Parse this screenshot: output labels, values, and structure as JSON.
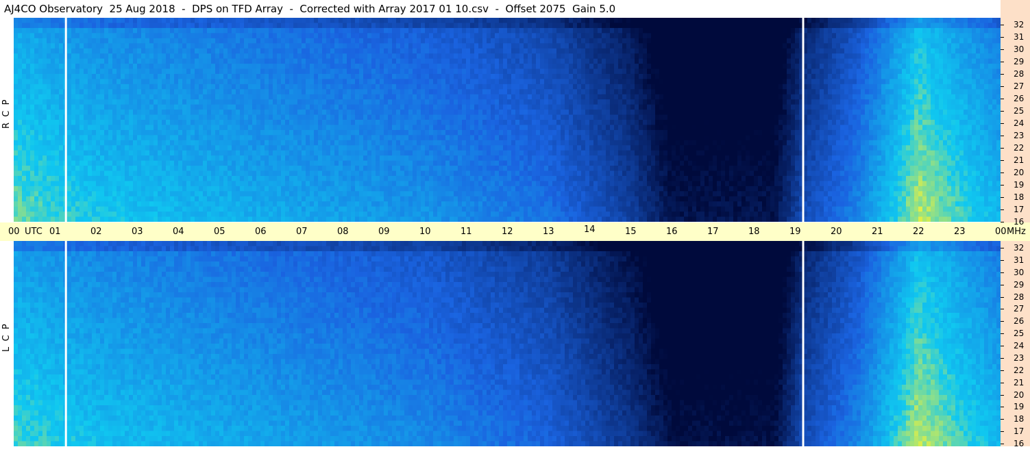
{
  "title": "AJ4CO Observatory  25 Aug 2018  -  DPS on TFD Array  -  Corrected with Array 2017 01 10.csv  -  Offset 2075  Gain 5.0",
  "colors": {
    "axis_band": "#ffffc8",
    "freq_panel": "#fde0c8",
    "low_intensity": "#000a3c",
    "mid_intensity": "#1a63e0",
    "high_intensity": "#10c8f0",
    "peak_intensity": "#e8f040",
    "hot_intensity": "#ff3060"
  },
  "chart_data": [
    {
      "type": "heatmap",
      "panel": "RCP",
      "ylabel": "R  C  P",
      "x_unit": "UTC",
      "y_unit": "MHz",
      "xlim": [
        0,
        24
      ],
      "ylim": [
        16,
        32
      ],
      "x_ticks": [
        "00",
        "01",
        "02",
        "03",
        "04",
        "05",
        "06",
        "07",
        "08",
        "09",
        "10",
        "11",
        "12",
        "13",
        "14",
        "15",
        "16",
        "17",
        "18",
        "19",
        "20",
        "21",
        "22",
        "23",
        "00"
      ],
      "y_ticks": [
        "32",
        "31",
        "30",
        "29",
        "28",
        "27",
        "26",
        "25",
        "24",
        "23",
        "22",
        "21",
        "20",
        "19",
        "18",
        "17",
        "16"
      ],
      "time_markers_utc": [
        1.27,
        19.2
      ],
      "intensity_profile": [
        {
          "utc": 0,
          "level": 0.78
        },
        {
          "utc": 2,
          "level": 0.7
        },
        {
          "utc": 6,
          "level": 0.62
        },
        {
          "utc": 10,
          "level": 0.55
        },
        {
          "utc": 13,
          "level": 0.45
        },
        {
          "utc": 15,
          "level": 0.25
        },
        {
          "utc": 16,
          "level": 0.05
        },
        {
          "utc": 18.5,
          "level": 0.05
        },
        {
          "utc": 19.2,
          "level": 0.3
        },
        {
          "utc": 20.5,
          "level": 0.5
        },
        {
          "utc": 22,
          "level": 0.85
        },
        {
          "utc": 24,
          "level": 0.65
        }
      ]
    },
    {
      "type": "heatmap",
      "panel": "LCP",
      "ylabel": "L  C  P",
      "x_unit": "UTC",
      "y_unit": "MHz",
      "xlim": [
        0,
        24
      ],
      "ylim": [
        16,
        32
      ],
      "y_ticks": [
        "32",
        "31",
        "30",
        "29",
        "28",
        "27",
        "26",
        "25",
        "24",
        "23",
        "22",
        "21",
        "20",
        "19",
        "18",
        "17",
        "16"
      ],
      "time_markers_utc": [
        1.27,
        19.2
      ],
      "intensity_profile": [
        {
          "utc": 0,
          "level": 0.75
        },
        {
          "utc": 2,
          "level": 0.68
        },
        {
          "utc": 6,
          "level": 0.6
        },
        {
          "utc": 10,
          "level": 0.52
        },
        {
          "utc": 13,
          "level": 0.4
        },
        {
          "utc": 15,
          "level": 0.2
        },
        {
          "utc": 16,
          "level": 0.03
        },
        {
          "utc": 18.5,
          "level": 0.03
        },
        {
          "utc": 19.2,
          "level": 0.3
        },
        {
          "utc": 20.5,
          "level": 0.5
        },
        {
          "utc": 22,
          "level": 0.85
        },
        {
          "utc": 24,
          "level": 0.65
        }
      ]
    }
  ],
  "time_axis": {
    "labels": [
      "00",
      "UTC",
      "01",
      "02",
      "03",
      "04",
      "05",
      "06",
      "07",
      "08",
      "09",
      "10",
      "11",
      "12",
      "13",
      "14",
      "15",
      "16",
      "17",
      "18",
      "19",
      "20",
      "21",
      "22",
      "23",
      "00",
      "MHz"
    ]
  }
}
